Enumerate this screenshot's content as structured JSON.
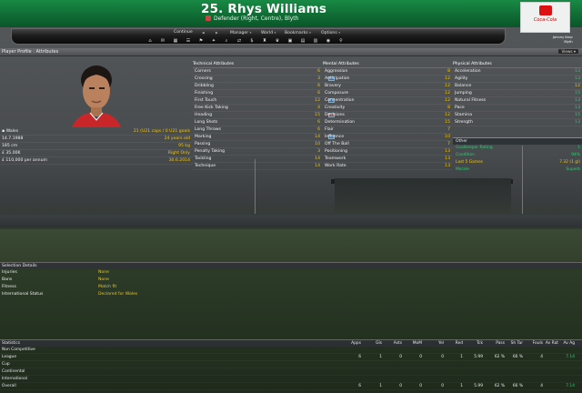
{
  "header": {
    "title": "25. Rhys Williams",
    "subtitle": "Defender (Right, Centre), Blyth",
    "user_line1": "Johnny Karp",
    "user_line2": "Blyth",
    "sponsor_text": "Coca-Cola"
  },
  "nav": {
    "continue": "Continue",
    "manager": "Manager",
    "world": "World",
    "bookmarks": "Bookmarks",
    "options": "Options",
    "icons": [
      "home-icon",
      "inbox-icon",
      "calendar-icon",
      "squad-icon",
      "tactics-icon",
      "training-icon",
      "scouting-icon",
      "transfers-icon",
      "finances-icon",
      "club-icon",
      "trophy-icon",
      "competitions-icon",
      "news-icon",
      "league-icon",
      "world-icon",
      "search-icon"
    ]
  },
  "profile_bar": {
    "title": "Player Profile : Attributes",
    "views": "Views"
  },
  "info": [
    {
      "label": "Wales",
      "value": "21 (U21 caps / 0 U21 goals"
    },
    {
      "label": "14.7.1988",
      "value": "24 years old"
    },
    {
      "label": "185 cm",
      "value": "95 kg"
    },
    {
      "label": "£ 35.00K",
      "value": "Right Only"
    },
    {
      "label": "£ 110,000 per annum",
      "value": "30.6.2014"
    }
  ],
  "technical": {
    "header": "Technical Attributes",
    "rows": [
      {
        "name": "Corners",
        "value": "6"
      },
      {
        "name": "Crossing",
        "value": "3"
      },
      {
        "name": "Dribbling",
        "value": "6"
      },
      {
        "name": "Finishing",
        "value": "6"
      },
      {
        "name": "First Touch",
        "value": "12"
      },
      {
        "name": "Free Kick Taking",
        "value": "4"
      },
      {
        "name": "Heading",
        "value": "15"
      },
      {
        "name": "Long Shots",
        "value": "6"
      },
      {
        "name": "Long Throws",
        "value": "6"
      },
      {
        "name": "Marking",
        "value": "14"
      },
      {
        "name": "Passing",
        "value": "10"
      },
      {
        "name": "Penalty Taking",
        "value": "3"
      },
      {
        "name": "Tackling",
        "value": "14"
      },
      {
        "name": "Technique",
        "value": "14"
      }
    ]
  },
  "mental": {
    "header": "Mental Attributes",
    "rows": [
      {
        "name": "Aggression",
        "value": "8"
      },
      {
        "name": "Anticipation",
        "value": "12"
      },
      {
        "name": "Bravery",
        "value": "12"
      },
      {
        "name": "Composure",
        "value": "12"
      },
      {
        "name": "Concentration",
        "value": "12"
      },
      {
        "name": "Creativity",
        "value": "8"
      },
      {
        "name": "Decisions",
        "value": "12"
      },
      {
        "name": "Determination",
        "value": "15"
      },
      {
        "name": "Flair",
        "value": "7"
      },
      {
        "name": "Influence",
        "value": "10"
      },
      {
        "name": "Off The Ball",
        "value": "7"
      },
      {
        "name": "Positioning",
        "value": "13"
      },
      {
        "name": "Teamwork",
        "value": "13"
      },
      {
        "name": "Work Rate",
        "value": "13"
      }
    ]
  },
  "physical": {
    "header": "Physical Attributes",
    "rows": [
      {
        "name": "Acceleration",
        "value": "13"
      },
      {
        "name": "Agility",
        "value": "13"
      },
      {
        "name": "Balance",
        "value": "12"
      },
      {
        "name": "Jumping",
        "value": "15"
      },
      {
        "name": "Natural Fitness",
        "value": "13"
      },
      {
        "name": "Pace",
        "value": "13"
      },
      {
        "name": "Stamina",
        "value": "15"
      },
      {
        "name": "Strength",
        "value": "13"
      }
    ]
  },
  "other": {
    "header": "Other",
    "rows": [
      {
        "name": "Goalkeeper Rating",
        "value": "1"
      },
      {
        "name": "Condition",
        "value": "94%"
      },
      {
        "name": "Last 5 Games",
        "value": "7.32 (1 gl)"
      },
      {
        "name": "Morale",
        "value": "Superb"
      }
    ]
  },
  "selection": {
    "header": "Selection Details",
    "rows": [
      {
        "name": "Injuries",
        "value": "None"
      },
      {
        "name": "Bans",
        "value": "None"
      },
      {
        "name": "Fitness",
        "value": "Match fit"
      },
      {
        "name": "International Status",
        "value": "Declared for Wales"
      }
    ]
  },
  "statistics": {
    "header": "Statistics",
    "columns": [
      "Apps",
      "Gls",
      "Asts",
      "MoM",
      "Yel",
      "Red",
      "Tck",
      "Pass",
      "Sh Tar",
      "Fouls",
      "Av Rat"
    ],
    "column_extra": "Av Ag",
    "rows": [
      {
        "name": "Non Competitive",
        "cells": [
          "",
          "",
          "",
          "",
          "",
          "",
          "",
          "",
          "",
          "",
          "",
          ""
        ]
      },
      {
        "name": "League",
        "cells": [
          "6",
          "1",
          "0",
          "0",
          "0",
          "1",
          "5.99",
          "62 %",
          "66 %",
          "4",
          "",
          "7.14"
        ]
      },
      {
        "name": "Cup",
        "cells": [
          "",
          "",
          "",
          "",
          "",
          "",
          "",
          "",
          "",
          "",
          "",
          ""
        ]
      },
      {
        "name": "Continental",
        "cells": [
          "",
          "",
          "",
          "",
          "",
          "",
          "",
          "",
          "",
          "",
          "",
          ""
        ]
      },
      {
        "name": "International",
        "cells": [
          "",
          "",
          "",
          "",
          "",
          "",
          "",
          "",
          "",
          "",
          "",
          ""
        ]
      },
      {
        "name": "Overall",
        "cells": [
          "6",
          "1",
          "0",
          "0",
          "0",
          "1",
          "5.99",
          "62 %",
          "66 %",
          "4",
          "",
          "7.14"
        ]
      }
    ]
  },
  "colors": {
    "header_green": "#188a45",
    "value_yellow": "#f1c40f",
    "value_green": "#2ecc71"
  }
}
